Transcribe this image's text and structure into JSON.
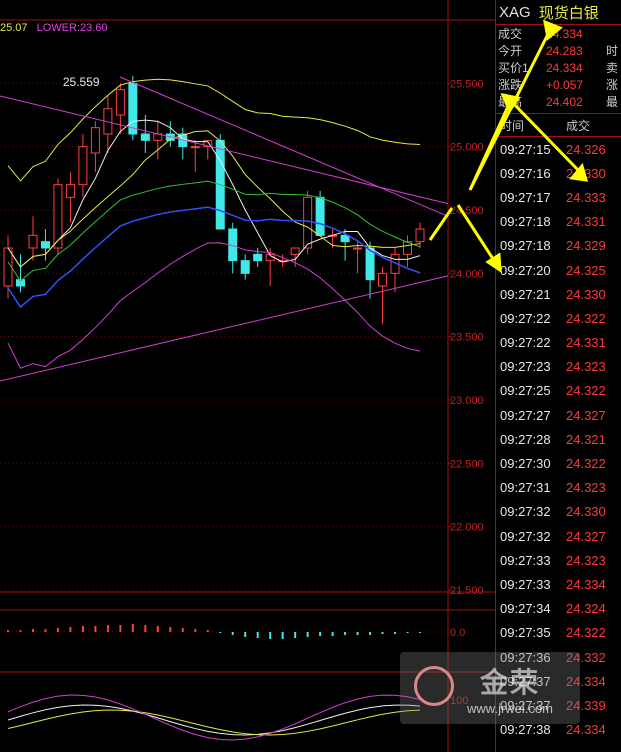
{
  "legend": {
    "upper": "25.07",
    "lower": "LOWER:23.60"
  },
  "quote": {
    "symbol": "XAG",
    "name": "现货白银",
    "rows": [
      {
        "label": "成交",
        "value": "24.334",
        "right": ""
      },
      {
        "label": "今开",
        "value": "24.283",
        "right": "时"
      },
      {
        "label": "买价1",
        "value": "24.334",
        "right": "卖"
      },
      {
        "label": "涨跌",
        "value": "+0.057",
        "right": "涨"
      },
      {
        "label": "最高",
        "value": "24.402",
        "right": "最"
      }
    ],
    "tick_header": {
      "time": "时间",
      "price": "成交"
    },
    "ticks": [
      {
        "time": "09:27:15",
        "price": "24.326"
      },
      {
        "time": "09:27:16",
        "price": "24.330"
      },
      {
        "time": "09:27:17",
        "price": "24.333"
      },
      {
        "time": "09:27:18",
        "price": "24.331"
      },
      {
        "time": "09:27:18",
        "price": "24.329"
      },
      {
        "time": "09:27:20",
        "price": "24.325"
      },
      {
        "time": "09:27:21",
        "price": "24.330"
      },
      {
        "time": "09:27:22",
        "price": "24.322"
      },
      {
        "time": "09:27:22",
        "price": "24.331"
      },
      {
        "time": "09:27:23",
        "price": "24.323"
      },
      {
        "time": "09:27:25",
        "price": "24.322"
      },
      {
        "time": "09:27:27",
        "price": "24.327"
      },
      {
        "time": "09:27:28",
        "price": "24.321"
      },
      {
        "time": "09:27:30",
        "price": "24.322"
      },
      {
        "time": "09:27:31",
        "price": "24.323"
      },
      {
        "time": "09:27:32",
        "price": "24.330"
      },
      {
        "time": "09:27:32",
        "price": "24.327"
      },
      {
        "time": "09:27:33",
        "price": "24.323"
      },
      {
        "time": "09:27:33",
        "price": "24.334"
      },
      {
        "time": "09:27:34",
        "price": "24.324"
      },
      {
        "time": "09:27:35",
        "price": "24.322"
      },
      {
        "time": "09:27:36",
        "price": "24.332"
      },
      {
        "time": "09:27:37",
        "price": "24.334"
      },
      {
        "time": "09:27:37",
        "price": "24.339"
      },
      {
        "time": "09:27:38",
        "price": "24.334"
      }
    ]
  },
  "watermark": {
    "title": "金荣",
    "url": "www.jrwei.com"
  },
  "chart_data": [
    {
      "type": "candlestick",
      "yticks": [
        25.5,
        25.0,
        24.5,
        24.0,
        23.5,
        23.0,
        22.5,
        22.0,
        21.5
      ],
      "ylabels": [
        "25.500",
        "25.000",
        "24.500",
        "24.000",
        "23.500",
        "23.000",
        "22.500",
        "22.000",
        "21.500"
      ],
      "ylim": [
        21.5,
        26.0
      ],
      "high_annotation": {
        "label": "25.559",
        "value": 25.559
      },
      "candles": [
        {
          "o": 23.9,
          "h": 24.3,
          "l": 23.8,
          "c": 24.2
        },
        {
          "o": 23.95,
          "h": 24.15,
          "l": 23.85,
          "c": 23.9
        },
        {
          "o": 24.2,
          "h": 24.45,
          "l": 24.1,
          "c": 24.3
        },
        {
          "o": 24.25,
          "h": 24.35,
          "l": 24.1,
          "c": 24.2
        },
        {
          "o": 24.2,
          "h": 24.75,
          "l": 24.15,
          "c": 24.7
        },
        {
          "o": 24.6,
          "h": 24.8,
          "l": 24.4,
          "c": 24.7
        },
        {
          "o": 24.7,
          "h": 25.1,
          "l": 24.6,
          "c": 25.0
        },
        {
          "o": 24.95,
          "h": 25.2,
          "l": 24.8,
          "c": 25.15
        },
        {
          "o": 25.1,
          "h": 25.4,
          "l": 24.95,
          "c": 25.3
        },
        {
          "o": 25.25,
          "h": 25.5,
          "l": 25.1,
          "c": 25.45
        },
        {
          "o": 25.5,
          "h": 25.559,
          "l": 25.05,
          "c": 25.1
        },
        {
          "o": 25.1,
          "h": 25.25,
          "l": 24.95,
          "c": 25.05
        },
        {
          "o": 25.05,
          "h": 25.2,
          "l": 24.9,
          "c": 25.1
        },
        {
          "o": 25.1,
          "h": 25.2,
          "l": 25.0,
          "c": 25.05
        },
        {
          "o": 25.1,
          "h": 25.15,
          "l": 24.9,
          "c": 25.0
        },
        {
          "o": 25.0,
          "h": 25.05,
          "l": 24.8,
          "c": 25.0
        },
        {
          "o": 25.0,
          "h": 25.05,
          "l": 24.9,
          "c": 25.05
        },
        {
          "o": 25.05,
          "h": 25.1,
          "l": 24.6,
          "c": 24.35
        },
        {
          "o": 24.35,
          "h": 24.4,
          "l": 24.0,
          "c": 24.1
        },
        {
          "o": 24.1,
          "h": 24.15,
          "l": 23.95,
          "c": 24.0
        },
        {
          "o": 24.15,
          "h": 24.2,
          "l": 24.05,
          "c": 24.1
        },
        {
          "o": 24.1,
          "h": 24.2,
          "l": 23.9,
          "c": 24.15
        },
        {
          "o": 24.1,
          "h": 24.15,
          "l": 24.05,
          "c": 24.1
        },
        {
          "o": 24.15,
          "h": 24.2,
          "l": 24.05,
          "c": 24.2
        },
        {
          "o": 24.2,
          "h": 24.65,
          "l": 24.15,
          "c": 24.6
        },
        {
          "o": 24.6,
          "h": 24.65,
          "l": 24.3,
          "c": 24.3
        },
        {
          "o": 24.3,
          "h": 24.35,
          "l": 24.2,
          "c": 24.3
        },
        {
          "o": 24.3,
          "h": 24.35,
          "l": 24.1,
          "c": 24.25
        },
        {
          "o": 24.2,
          "h": 24.25,
          "l": 24.0,
          "c": 24.2
        },
        {
          "o": 24.2,
          "h": 24.25,
          "l": 23.8,
          "c": 23.95
        },
        {
          "o": 23.9,
          "h": 24.05,
          "l": 23.6,
          "c": 24.0
        },
        {
          "o": 24.0,
          "h": 24.2,
          "l": 23.85,
          "c": 24.15
        },
        {
          "o": 24.15,
          "h": 24.3,
          "l": 24.05,
          "c": 24.25
        },
        {
          "o": 24.25,
          "h": 24.4,
          "l": 24.2,
          "c": 24.35
        }
      ]
    },
    {
      "type": "bar",
      "label": "0.0",
      "values": [
        0.02,
        0.02,
        0.03,
        0.03,
        0.04,
        0.05,
        0.06,
        0.06,
        0.07,
        0.07,
        0.08,
        0.07,
        0.06,
        0.05,
        0.04,
        0.03,
        0.02,
        -0.01,
        -0.03,
        -0.05,
        -0.06,
        -0.07,
        -0.07,
        -0.06,
        -0.05,
        -0.04,
        -0.04,
        -0.03,
        -0.03,
        -0.03,
        -0.02,
        -0.02,
        -0.01,
        -0.01
      ],
      "ylim": [
        -0.2,
        0.2
      ]
    },
    {
      "type": "line",
      "yticks": [
        100
      ],
      "ylabels": [
        "100"
      ],
      "ylim": [
        -20,
        130
      ]
    }
  ]
}
